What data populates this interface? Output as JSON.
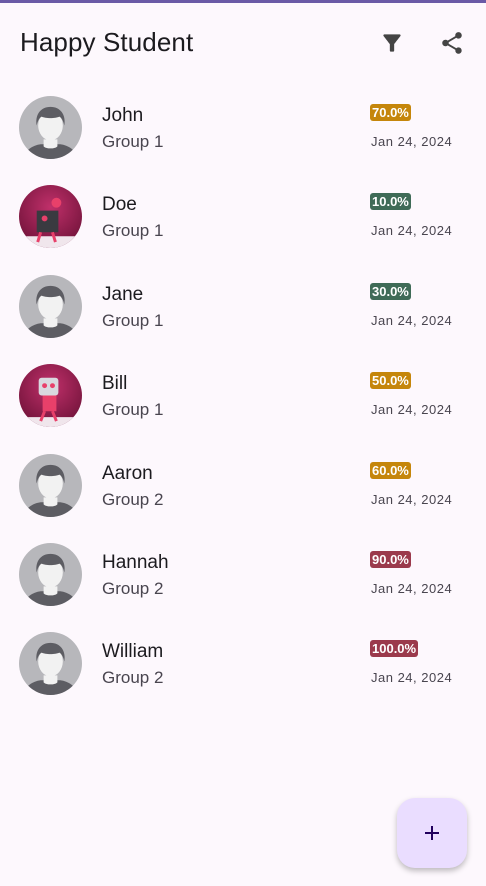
{
  "app": {
    "title": "Happy Student"
  },
  "toolbar": {
    "filter_icon": "filter-icon",
    "share_icon": "share-icon"
  },
  "students": [
    {
      "name": "John",
      "group": "Group 1",
      "score": "70.0%",
      "date": "Jan 24, 2024",
      "badge_color": "#c5860b",
      "avatar": "default-avatar"
    },
    {
      "name": "Doe",
      "group": "Group 1",
      "score": "10.0%",
      "date": "Jan 24, 2024",
      "badge_color": "#3f6b57",
      "avatar": "pink-character-avatar"
    },
    {
      "name": "Jane",
      "group": "Group 1",
      "score": "30.0%",
      "date": "Jan 24, 2024",
      "badge_color": "#3f6b57",
      "avatar": "default-avatar"
    },
    {
      "name": "Bill",
      "group": "Group 1",
      "score": "50.0%",
      "date": "Jan 24, 2024",
      "badge_color": "#c5860b",
      "avatar": "pink-robot-avatar"
    },
    {
      "name": "Aaron",
      "group": "Group 2",
      "score": "60.0%",
      "date": "Jan 24, 2024",
      "badge_color": "#c5860b",
      "avatar": "default-avatar"
    },
    {
      "name": "Hannah",
      "group": "Group 2",
      "score": "90.0%",
      "date": "Jan 24, 2024",
      "badge_color": "#9b3a4c",
      "avatar": "default-avatar"
    },
    {
      "name": "William",
      "group": "Group 2",
      "score": "100.0%",
      "date": "Jan 24, 2024",
      "badge_color": "#9b3a4c",
      "avatar": "default-avatar"
    }
  ],
  "fab": {
    "icon": "plus-icon"
  },
  "colors": {
    "accent": "#6a5aa6",
    "fab_background": "#eaddff",
    "background": "#fdf8fd"
  }
}
